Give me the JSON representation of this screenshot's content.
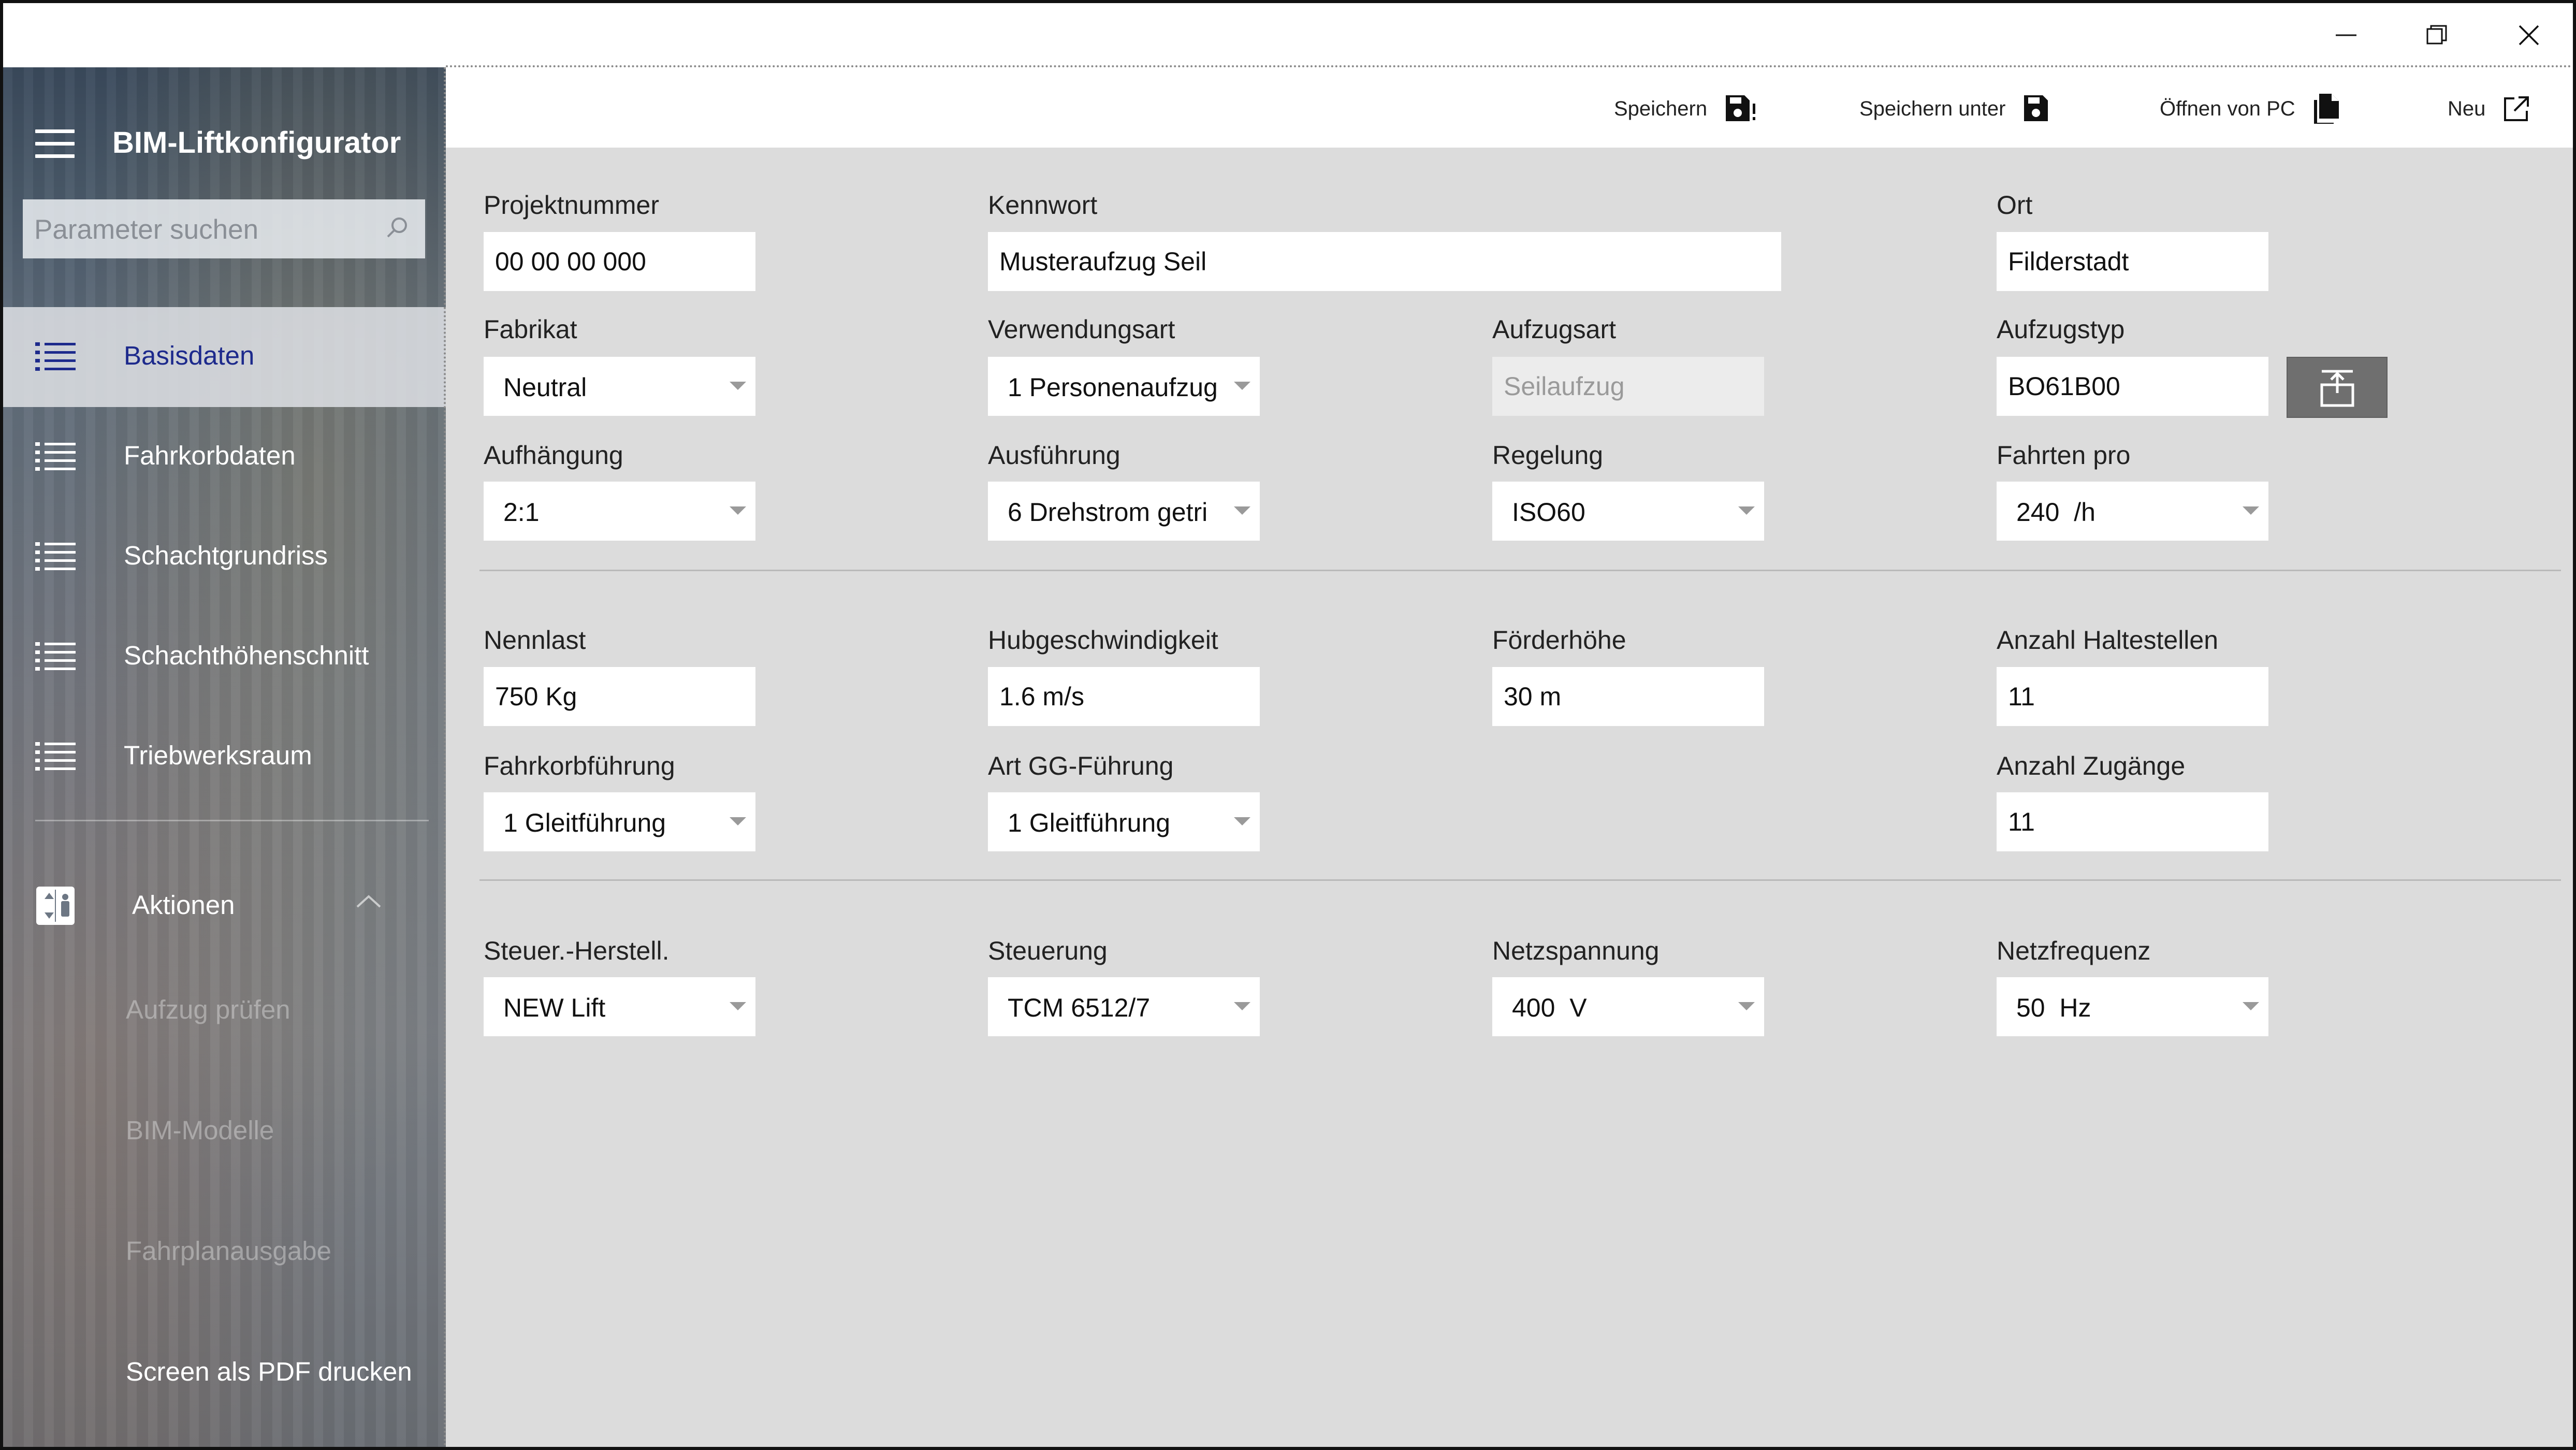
{
  "window": {
    "minimize_label": "—",
    "restore_label": "",
    "close_label": ""
  },
  "app": {
    "title": "BIM-Liftkonfigurator"
  },
  "search": {
    "placeholder": "Parameter suchen"
  },
  "nav": {
    "items": [
      {
        "label": "Basisdaten",
        "active": true
      },
      {
        "label": "Fahrkorbdaten"
      },
      {
        "label": "Schachtgrundriss"
      },
      {
        "label": "Schachthöhenschnitt"
      },
      {
        "label": "Triebwerksraum"
      }
    ],
    "aktionen": {
      "label": "Aktionen",
      "items": [
        {
          "label": "Aufzug prüfen",
          "enabled": false
        },
        {
          "label": "BIM-Modelle",
          "enabled": false
        },
        {
          "label": "Fahrplanausgabe",
          "enabled": false
        },
        {
          "label": "Screen als PDF drucken",
          "enabled": true
        }
      ]
    }
  },
  "toolbar": {
    "save_label": "Speichern",
    "save_as_label": "Speichern unter",
    "open_label": "Öffnen von PC",
    "new_label": "Neu"
  },
  "form": {
    "projektnummer": {
      "label": "Projektnummer",
      "value": "00 00 00 000"
    },
    "kennwort": {
      "label": "Kennwort",
      "value": "Musteraufzug Seil"
    },
    "ort": {
      "label": "Ort",
      "value": "Filderstadt"
    },
    "fabrikat": {
      "label": "Fabrikat",
      "value": "Neutral"
    },
    "verwendungsart": {
      "label": "Verwendungsart",
      "value": "1 Personenaufzug"
    },
    "aufzugsart": {
      "label": "Aufzugsart",
      "value": "Seilaufzug"
    },
    "aufzugstyp": {
      "label": "Aufzugstyp",
      "value": "BO61B00"
    },
    "aufhaengung": {
      "label": "Aufhängung",
      "value": "2:1"
    },
    "ausfuehrung": {
      "label": "Ausführung",
      "value": "6 Drehstrom getri"
    },
    "regelung": {
      "label": "Regelung",
      "value": "ISO60"
    },
    "fahrten_pro": {
      "label": "Fahrten pro",
      "value": "240  /h"
    },
    "nennlast": {
      "label": "Nennlast",
      "value": "750 Kg"
    },
    "hubgeschwindigkeit": {
      "label": "Hubgeschwindigkeit",
      "value": "1.6 m/s"
    },
    "foerderhoehe": {
      "label": "Förderhöhe",
      "value": "30 m"
    },
    "anzahl_haltestellen": {
      "label": "Anzahl Haltestellen",
      "value": "11"
    },
    "fahrkorbfuehrung": {
      "label": "Fahrkorbführung",
      "value": "1 Gleitführung"
    },
    "art_gg_fuehrung": {
      "label": "Art GG-Führung",
      "value": "1 Gleitführung"
    },
    "anzahl_zugaenge": {
      "label": "Anzahl Zugänge",
      "value": "11"
    },
    "steuer_herstell": {
      "label": "Steuer.-Herstell.",
      "value": "NEW Lift"
    },
    "steuerung": {
      "label": "Steuerung",
      "value": "TCM 6512/7"
    },
    "netzspannung": {
      "label": "Netzspannung",
      "value": "400  V"
    },
    "netzfrequenz": {
      "label": "Netzfrequenz",
      "value": "50  Hz"
    }
  },
  "colors": {
    "active_nav_text": "#1d2a8c",
    "main_background": "#dcdcdc",
    "lift_button": "#6f6f6f"
  }
}
